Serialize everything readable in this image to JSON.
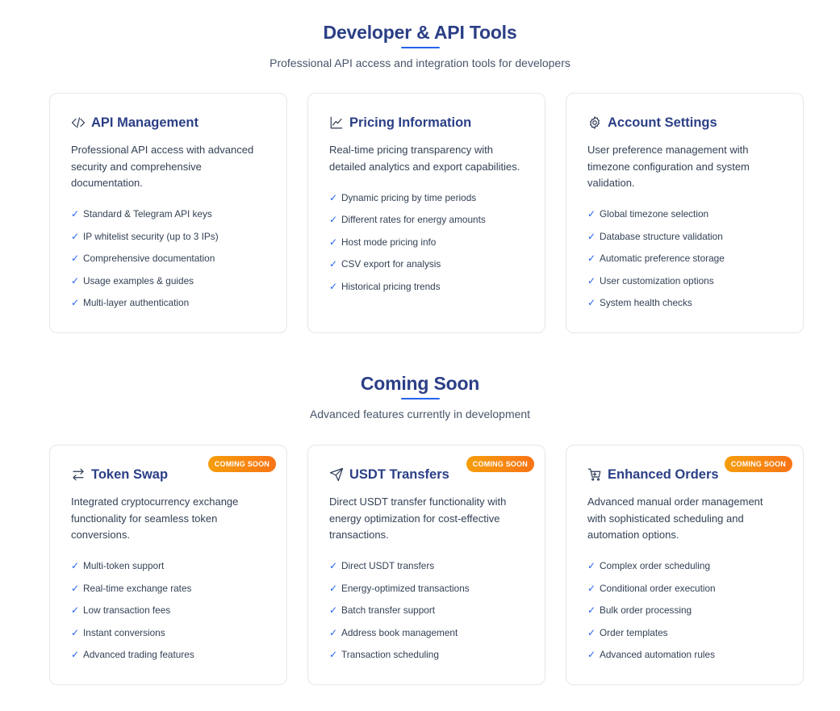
{
  "developer": {
    "title": "Developer & API Tools",
    "subtitle": "Professional API access and integration tools for developers",
    "cards": [
      {
        "icon": "code-icon",
        "title": "API Management",
        "description": "Professional API access with advanced security and comprehensive documentation.",
        "features": [
          "Standard & Telegram API keys",
          "IP whitelist security (up to 3 IPs)",
          "Comprehensive documentation",
          "Usage examples & guides",
          "Multi-layer authentication"
        ]
      },
      {
        "icon": "trend-chart-icon",
        "title": "Pricing Information",
        "description": "Real-time pricing transparency with detailed analytics and export capabilities.",
        "features": [
          "Dynamic pricing by time periods",
          "Different rates for energy amounts",
          "Host mode pricing info",
          "CSV export for analysis",
          "Historical pricing trends"
        ]
      },
      {
        "icon": "gear-icon",
        "title": "Account Settings",
        "description": "User preference management with timezone configuration and system validation.",
        "features": [
          "Global timezone selection",
          "Database structure validation",
          "Automatic preference storage",
          "User customization options",
          "System health checks"
        ]
      }
    ]
  },
  "coming_soon": {
    "title": "Coming Soon",
    "subtitle": "Advanced features currently in development",
    "badge_label": "COMING SOON",
    "cards": [
      {
        "icon": "swap-arrows-icon",
        "title": "Token Swap",
        "description": "Integrated cryptocurrency exchange functionality for seamless token conversions.",
        "features": [
          "Multi-token support",
          "Real-time exchange rates",
          "Low transaction fees",
          "Instant conversions",
          "Advanced trading features"
        ]
      },
      {
        "icon": "send-icon",
        "title": "USDT Transfers",
        "description": "Direct USDT transfer functionality with energy optimization for cost-effective transactions.",
        "features": [
          "Direct USDT transfers",
          "Energy-optimized transactions",
          "Batch transfer support",
          "Address book management",
          "Transaction scheduling"
        ]
      },
      {
        "icon": "cart-icon",
        "title": "Enhanced Orders",
        "description": "Advanced manual order management with sophisticated scheduling and automation options.",
        "features": [
          "Complex order scheduling",
          "Conditional order execution",
          "Bulk order processing",
          "Order templates",
          "Advanced automation rules"
        ]
      }
    ]
  },
  "check_glyph": "✓",
  "colors": {
    "heading": "#2b3f86",
    "accent": "#2563eb",
    "badge_start": "#f59e0b",
    "badge_end": "#f97316"
  }
}
